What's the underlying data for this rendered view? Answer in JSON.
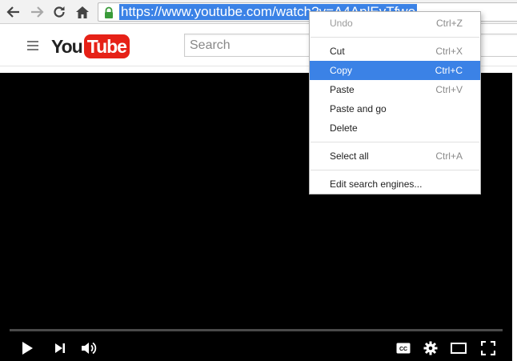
{
  "browser": {
    "url": "https://www.youtube.com/watch?v=A4AplEvTfwo",
    "url_visible": "https://www.youtube.com/watch?v=A4AplEvTfwo"
  },
  "header": {
    "logo_you": "You",
    "logo_tube": "Tube",
    "search_placeholder": "Search"
  },
  "player": {
    "progress_fraction": 0.0
  },
  "context_menu": {
    "items": [
      {
        "label": "Undo",
        "shortcut": "Ctrl+Z",
        "disabled": true
      },
      {
        "label": "Cut",
        "shortcut": "Ctrl+X"
      },
      {
        "label": "Copy",
        "shortcut": "Ctrl+C",
        "highlighted": true
      },
      {
        "label": "Paste",
        "shortcut": "Ctrl+V"
      },
      {
        "label": "Paste and go",
        "shortcut": ""
      },
      {
        "label": "Delete",
        "shortcut": ""
      },
      {
        "label": "Select all",
        "shortcut": "Ctrl+A"
      },
      {
        "label": "Edit search engines...",
        "shortcut": ""
      }
    ]
  },
  "colors": {
    "selection": "#3b82e6",
    "youtube_red": "#e62117",
    "player_bg": "#000000"
  },
  "icons": [
    "back-icon",
    "forward-icon",
    "reload-icon",
    "home-icon",
    "lock-icon",
    "menu-icon",
    "play-icon",
    "next-icon",
    "volume-icon",
    "captions-icon",
    "settings-icon",
    "theater-icon",
    "fullscreen-icon"
  ]
}
